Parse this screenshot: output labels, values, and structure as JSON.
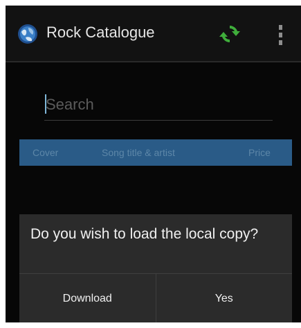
{
  "app": {
    "title": "Rock Catalogue",
    "icon": "rock-globe-icon"
  },
  "action_bar": {
    "refresh_icon": "refresh-icon",
    "overflow_icon": "overflow-menu-icon"
  },
  "search": {
    "placeholder": "Search",
    "value": ""
  },
  "table": {
    "columns": [
      "Cover",
      "Song title & artist",
      "Price"
    ]
  },
  "dialog": {
    "message": "Do you wish to load the local copy?",
    "buttons": [
      "Download",
      "Yes"
    ]
  },
  "colors": {
    "background": "#070707",
    "action_bar": "#121212",
    "table_header": "#2a5b87",
    "dialog": "#2b2b2b",
    "refresh_green": "#3fae3b"
  }
}
